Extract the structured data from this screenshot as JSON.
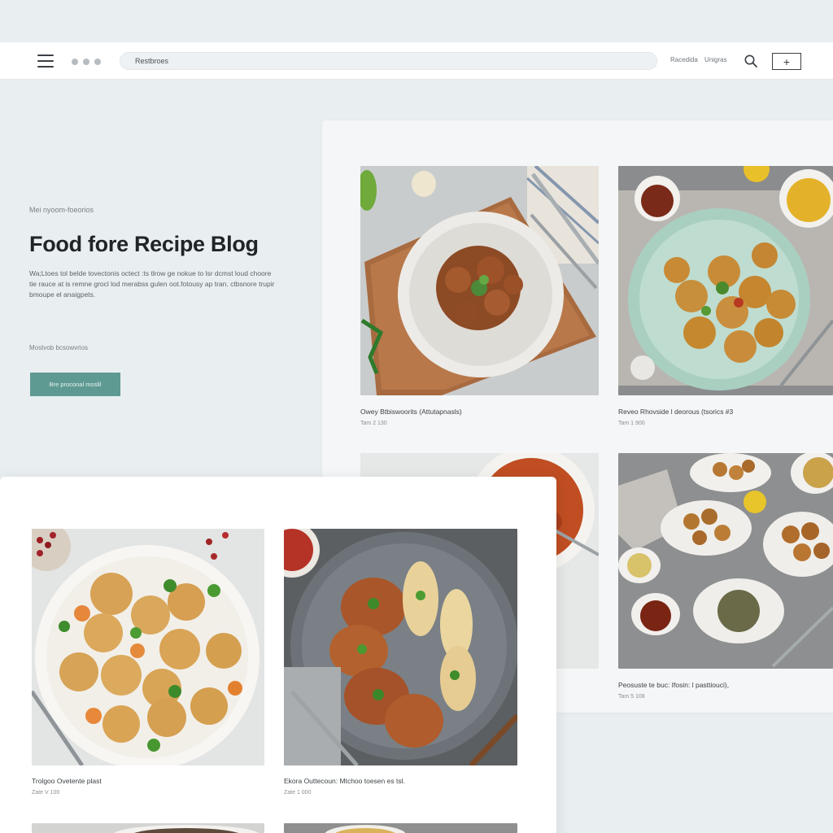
{
  "topbar": {
    "address": "Restbroes",
    "links": [
      "Racedida",
      "Unigras"
    ]
  },
  "hero": {
    "eyebrow": "Mei nyoom-foeorios",
    "title": "Food fore Recipe Blog",
    "description": "Wa;Ltoes tol belde tovectonis octect :ts tlrow ge nokue to lsr dcmst loud choore tie rauce at is remne grocl lod merabss gulen oot.fotousy ap tran. ctbsnore trupir bmoupe el anaigpets.",
    "subtext": "Mostvob bcsowvrios",
    "cta_label": "Bre proconal moslil"
  },
  "recipes_top": [
    {
      "title": "Owey Btbiswoorits (Attutapnasls)",
      "meta": "Tam 2 130"
    },
    {
      "title": "Reveo Rhovside l deorous (tsorics #3",
      "meta": "Tam 1 900"
    },
    {
      "title": "Peosuste te buc: Ifosin: l pasttiouci),",
      "meta": "Tam 5 108"
    }
  ],
  "recipes_bottom": [
    {
      "title": "Trolgoo Ovetente plast",
      "meta": "Zate V 100"
    },
    {
      "title": "Ekora Outtecoun: Mtchoo toesen es tsl.",
      "meta": "Zate 1 000"
    }
  ],
  "colors": {
    "accent": "#5f9a92",
    "background": "#e9eef1"
  },
  "icons": [
    "hamburger-icon",
    "search-icon",
    "plus-icon"
  ]
}
